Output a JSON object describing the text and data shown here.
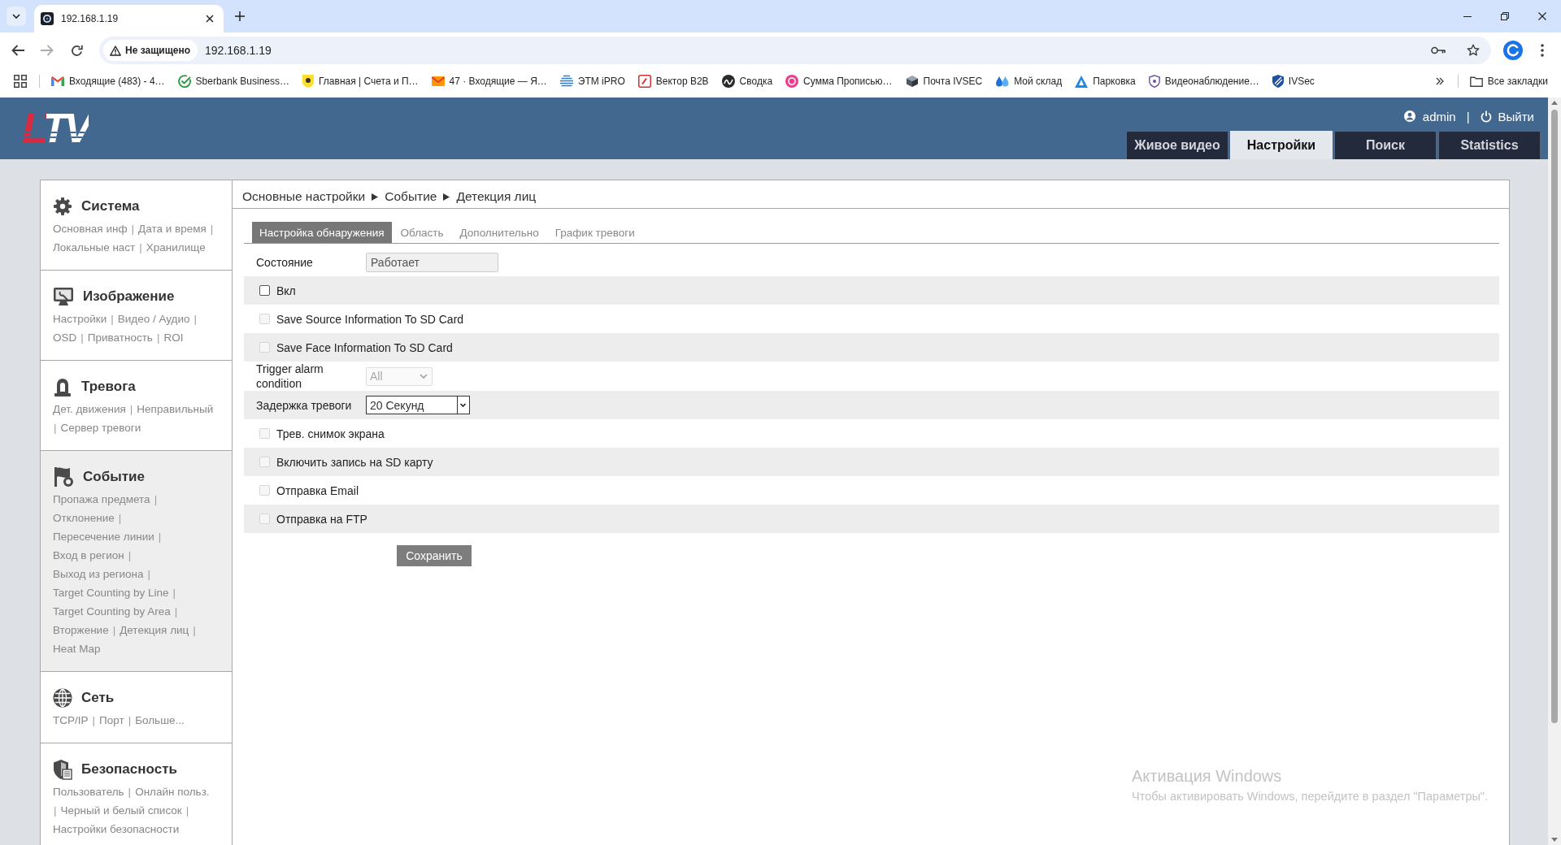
{
  "browser": {
    "tab": {
      "title": "192.168.1.19"
    },
    "forward_disabled": true,
    "address_bar": {
      "security_label": "Не защищено",
      "url": "192.168.1.19"
    },
    "bookmarks": [
      {
        "label": "Входящие (483) - 4…"
      },
      {
        "label": "Sberbank Business…"
      },
      {
        "label": "Главная | Счета и П…"
      },
      {
        "label": "47 · Входящие — Я…"
      },
      {
        "label": "ЭТМ iPRO"
      },
      {
        "label": "Вектор B2B"
      },
      {
        "label": "Сводка"
      },
      {
        "label": "Сумма Прописью…"
      },
      {
        "label": "Почта IVSEC"
      },
      {
        "label": "Мой склад"
      },
      {
        "label": "Парковка"
      },
      {
        "label": "Видеонаблюдение…"
      },
      {
        "label": "IVSec"
      }
    ],
    "all_bookmarks": "Все закладки"
  },
  "header": {
    "logo": "LTV",
    "user": "admin",
    "separator": "|",
    "logout": "Выйти",
    "tabs": [
      {
        "label": "Живое видео",
        "selected": false
      },
      {
        "label": "Настройки",
        "selected": true
      },
      {
        "label": "Поиск",
        "selected": false
      },
      {
        "label": "Statistics",
        "selected": false
      }
    ]
  },
  "sidebar": {
    "sections": [
      {
        "title": "Система",
        "selected": false,
        "lines": [
          {
            "items": [
              {
                "kind": "link",
                "text": "Основная инф"
              },
              {
                "kind": "sep",
                "text": "|"
              },
              {
                "kind": "link",
                "text": "Дата и время"
              },
              {
                "kind": "sep",
                "text": "|"
              }
            ]
          },
          {
            "items": [
              {
                "kind": "link",
                "text": "Локальные наст"
              },
              {
                "kind": "sep",
                "text": "|"
              },
              {
                "kind": "link",
                "text": "Хранилище"
              }
            ]
          }
        ]
      },
      {
        "title": "Изображение",
        "selected": false,
        "lines": [
          {
            "items": [
              {
                "kind": "link",
                "text": "Настройки"
              },
              {
                "kind": "sep",
                "text": "|"
              },
              {
                "kind": "link",
                "text": "Видео / Аудио"
              },
              {
                "kind": "sep",
                "text": "|"
              }
            ]
          },
          {
            "items": [
              {
                "kind": "link",
                "text": "OSD"
              },
              {
                "kind": "sep",
                "text": "|"
              },
              {
                "kind": "link",
                "text": "Приватность"
              },
              {
                "kind": "sep",
                "text": "|"
              },
              {
                "kind": "link",
                "text": "ROI"
              }
            ]
          }
        ]
      },
      {
        "title": "Тревога",
        "selected": false,
        "lines": [
          {
            "items": [
              {
                "kind": "link",
                "text": "Дет. движения"
              },
              {
                "kind": "sep",
                "text": "|"
              },
              {
                "kind": "link",
                "text": "Неправильный"
              }
            ]
          },
          {
            "items": [
              {
                "kind": "sep",
                "text": "|"
              },
              {
                "kind": "link",
                "text": "Сервер тревоги"
              }
            ]
          }
        ]
      },
      {
        "title": "Событие",
        "selected": true,
        "lines": [
          {
            "items": [
              {
                "kind": "link",
                "text": "Пропажа предмета"
              },
              {
                "kind": "sep",
                "text": "|"
              }
            ]
          },
          {
            "items": [
              {
                "kind": "link",
                "text": "Отклонение"
              },
              {
                "kind": "sep",
                "text": "|"
              }
            ]
          },
          {
            "items": [
              {
                "kind": "link",
                "text": "Пересечение линии"
              },
              {
                "kind": "sep",
                "text": "|"
              }
            ]
          },
          {
            "items": [
              {
                "kind": "link",
                "text": "Вход в регион"
              },
              {
                "kind": "sep",
                "text": "|"
              }
            ]
          },
          {
            "items": [
              {
                "kind": "link",
                "text": "Выход из региона"
              },
              {
                "kind": "sep",
                "text": "|"
              }
            ]
          },
          {
            "items": [
              {
                "kind": "link",
                "text": "Target Counting by Line"
              },
              {
                "kind": "sep",
                "text": "|"
              }
            ]
          },
          {
            "items": [
              {
                "kind": "link",
                "text": "Target Counting by Area"
              },
              {
                "kind": "sep",
                "text": "|"
              }
            ]
          },
          {
            "items": [
              {
                "kind": "link",
                "text": "Вторжение"
              },
              {
                "kind": "sep",
                "text": "|"
              },
              {
                "kind": "link",
                "text": "Детекция лиц"
              },
              {
                "kind": "sep",
                "text": "|"
              }
            ]
          },
          {
            "items": [
              {
                "kind": "link",
                "text": "Heat Map"
              }
            ]
          }
        ]
      },
      {
        "title": "Сеть",
        "selected": false,
        "lines": [
          {
            "items": [
              {
                "kind": "link",
                "text": "TCP/IP"
              },
              {
                "kind": "sep",
                "text": "|"
              },
              {
                "kind": "link",
                "text": "Порт"
              },
              {
                "kind": "sep",
                "text": "|"
              },
              {
                "kind": "link",
                "text": "Больше..."
              }
            ]
          }
        ]
      },
      {
        "title": "Безопасность",
        "selected": false,
        "lines": [
          {
            "items": [
              {
                "kind": "link",
                "text": "Пользователь"
              },
              {
                "kind": "sep",
                "text": "|"
              },
              {
                "kind": "link",
                "text": "Онлайн польз."
              }
            ]
          },
          {
            "items": [
              {
                "kind": "sep",
                "text": "|"
              },
              {
                "kind": "link",
                "text": "Черный и белый список"
              },
              {
                "kind": "sep",
                "text": "|"
              }
            ]
          },
          {
            "items": [
              {
                "kind": "link",
                "text": "Настройки безопасности"
              }
            ]
          }
        ]
      }
    ]
  },
  "main": {
    "breadcrumb": [
      "Основные настройки",
      "Событие",
      "Детекция лиц"
    ],
    "tabs": [
      {
        "label": "Настройка обнаружения",
        "selected": true
      },
      {
        "label": "Область",
        "selected": false
      },
      {
        "label": "Дополнительно",
        "selected": false
      },
      {
        "label": "График тревоги",
        "selected": false
      }
    ],
    "form": {
      "rows": [
        {
          "kind": "field",
          "label": "Состояние",
          "value": "Работает",
          "disabled": true
        },
        {
          "kind": "checkbox",
          "label": "Вкл",
          "checked": false,
          "disabled": false
        },
        {
          "kind": "checkbox",
          "label": "Save Source Information To SD Card",
          "checked": false,
          "disabled": true
        },
        {
          "kind": "checkbox",
          "label": "Save Face Information To SD Card",
          "checked": false,
          "disabled": true
        },
        {
          "kind": "select",
          "label": "Trigger alarm condition",
          "value": "All",
          "disabled": true
        },
        {
          "kind": "select",
          "label": "Задержка тревоги",
          "value": "20 Секунд",
          "disabled": false
        },
        {
          "kind": "checkbox",
          "label": "Трев. снимок экрана",
          "checked": false,
          "disabled": true
        },
        {
          "kind": "checkbox",
          "label": "Включить запись на SD карту",
          "checked": false,
          "disabled": true
        },
        {
          "kind": "checkbox",
          "label": "Отправка Email",
          "checked": false,
          "disabled": true
        },
        {
          "kind": "checkbox",
          "label": "Отправка на FTP",
          "checked": false,
          "disabled": true
        }
      ]
    },
    "save_button": "Сохранить"
  },
  "windows_notice": {
    "title": "Активация Windows",
    "text": "Чтобы активировать Windows, перейдите в раздел \"Параметры\"."
  }
}
